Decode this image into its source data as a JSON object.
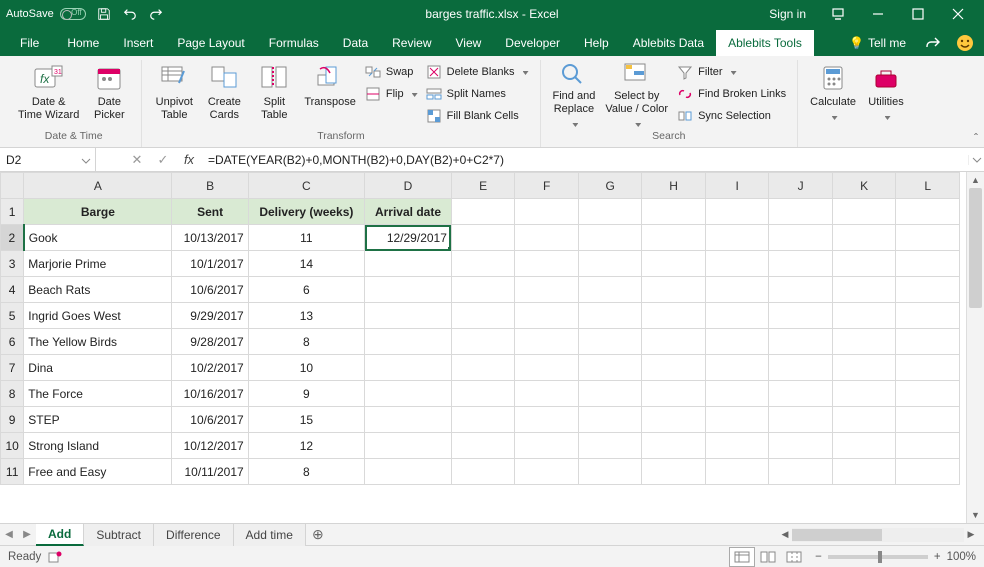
{
  "titlebar": {
    "autosave_label": "AutoSave",
    "filename": "barges traffic.xlsx",
    "app_suffix": "  -  Excel",
    "signin": "Sign in"
  },
  "tabs": {
    "items": [
      "File",
      "Home",
      "Insert",
      "Page Layout",
      "Formulas",
      "Data",
      "Review",
      "View",
      "Developer",
      "Help",
      "Ablebits Data",
      "Ablebits Tools"
    ],
    "active_index": 11,
    "tellme": "Tell me"
  },
  "ribbon": {
    "groups": {
      "datetime": {
        "label": "Date & Time",
        "btn_datetime_wizard": "Date &\nTime Wizard",
        "btn_date_picker": "Date\nPicker"
      },
      "transform": {
        "label": "Transform",
        "btn_unpivot": "Unpivot\nTable",
        "btn_create_cards": "Create\nCards",
        "btn_split_table": "Split\nTable",
        "btn_transpose": "Transpose",
        "btn_swap": "Swap",
        "btn_flip": "Flip",
        "btn_delete_blanks": "Delete Blanks",
        "btn_split_names": "Split Names",
        "btn_fill_blank": "Fill Blank Cells"
      },
      "search": {
        "label": "Search",
        "btn_find_replace": "Find and\nReplace",
        "btn_select_by": "Select by\nValue / Color",
        "btn_filter": "Filter",
        "btn_broken_links": "Find Broken Links",
        "btn_sync_sel": "Sync Selection"
      },
      "right": {
        "btn_calculate": "Calculate",
        "btn_utilities": "Utilities"
      }
    }
  },
  "formula_bar": {
    "namebox": "D2",
    "formula": "=DATE(YEAR(B2)+0,MONTH(B2)+0,DAY(B2)+0+C2*7)"
  },
  "grid": {
    "col_headers": [
      "A",
      "B",
      "C",
      "D",
      "E",
      "F",
      "G",
      "H",
      "I",
      "J",
      "K",
      "L"
    ],
    "row1": {
      "A": "Barge",
      "B": "Sent",
      "C": "Delivery  (weeks)",
      "D": "Arrival date"
    },
    "rows": [
      {
        "n": "2",
        "A": "Gook",
        "B": "10/13/2017",
        "C": "11",
        "D": "12/29/2017"
      },
      {
        "n": "3",
        "A": "Marjorie Prime",
        "B": "10/1/2017",
        "C": "14",
        "D": ""
      },
      {
        "n": "4",
        "A": "Beach Rats",
        "B": "10/6/2017",
        "C": "6",
        "D": ""
      },
      {
        "n": "5",
        "A": "Ingrid Goes West",
        "B": "9/29/2017",
        "C": "13",
        "D": ""
      },
      {
        "n": "6",
        "A": "The Yellow Birds",
        "B": "9/28/2017",
        "C": "8",
        "D": ""
      },
      {
        "n": "7",
        "A": "Dina",
        "B": "10/2/2017",
        "C": "10",
        "D": ""
      },
      {
        "n": "8",
        "A": "The Force",
        "B": "10/16/2017",
        "C": "9",
        "D": ""
      },
      {
        "n": "9",
        "A": "STEP",
        "B": "10/6/2017",
        "C": "15",
        "D": ""
      },
      {
        "n": "10",
        "A": "Strong Island",
        "B": "10/12/2017",
        "C": "12",
        "D": ""
      },
      {
        "n": "11",
        "A": "Free and Easy",
        "B": "10/11/2017",
        "C": "8",
        "D": ""
      }
    ],
    "selected_cell": "D2"
  },
  "sheet_tabs": {
    "items": [
      "Add",
      "Subtract",
      "Difference",
      "Add time"
    ],
    "active_index": 0
  },
  "statusbar": {
    "mode": "Ready",
    "zoom": "100%"
  }
}
